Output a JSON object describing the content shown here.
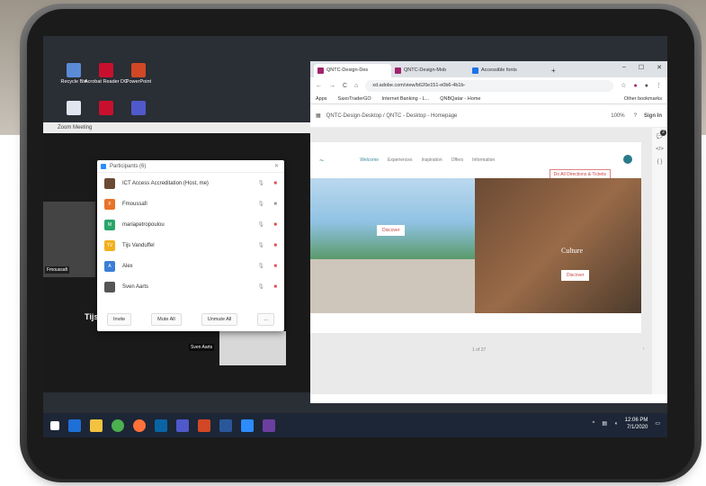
{
  "desktop": {
    "icons": [
      {
        "label": "Recycle Bin",
        "color": "#5b8bd6"
      },
      {
        "label": "Acrobat Reader DC",
        "color": "#c8102e"
      },
      {
        "label": "PowerPoint",
        "color": "#d24726"
      }
    ]
  },
  "zoom": {
    "window_title": "Zoom Meeting",
    "video_label_left": "Fmoussafi",
    "speaker_name": "Tijs",
    "video_label_bottom": "Sven Aarts",
    "participants": {
      "title": "Participants (6)",
      "list": [
        {
          "name": "ICT Access Accreditation (Host, me)",
          "avatar_color": "#6b4a34",
          "initial": ""
        },
        {
          "name": "Fmoussafi",
          "avatar_color": "#e8732a",
          "initial": "F"
        },
        {
          "name": "mariapetropoulou",
          "avatar_color": "#2aa56a",
          "initial": "M"
        },
        {
          "name": "Tijs Vanduffel",
          "avatar_color": "#f2b01e",
          "initial": "TV"
        },
        {
          "name": "Alex",
          "avatar_color": "#3b7fd6",
          "initial": "A"
        },
        {
          "name": "Sven Aarts",
          "avatar_color": "#555555",
          "initial": ""
        }
      ],
      "buttons": {
        "invite": "Invite",
        "mute_all": "Mute All",
        "unmute_all": "Unmute All",
        "more": "..."
      }
    }
  },
  "browser": {
    "tabs": [
      {
        "label": "QNTC-Design-Des",
        "color": "#a1246b"
      },
      {
        "label": "QNTC-Design-Mob",
        "color": "#a1246b"
      },
      {
        "label": "Accessible fonts",
        "color": "#1a73e8"
      }
    ],
    "new_tab": "+",
    "url": "xd.adobe.com/view/b620e151-e0b6-4b1b-",
    "bookmarks": [
      "Apps",
      "SaxoTraderGO",
      "Internet Banking - L...",
      "QNBQatar - Home",
      "Other bookmarks"
    ],
    "xd": {
      "breadcrumb": "QNTC-Design-Desktop  /  QNTC - Desktop - Homepage",
      "zoom": "100%",
      "sign_in": "Sign In",
      "notification_count": "2",
      "nav_items": [
        "Welcome",
        "Experiences",
        "Inspiration",
        "Offers",
        "Information"
      ],
      "cta_top": "Do All Directions & Tickets",
      "hero_left_cta": "Discover",
      "hero_right_word": "Culture",
      "hero_right_cta": "Discover",
      "page_indicator": "1 of 27"
    }
  },
  "taskbar": {
    "time": "12:06 PM",
    "date": "7/1/2020"
  }
}
